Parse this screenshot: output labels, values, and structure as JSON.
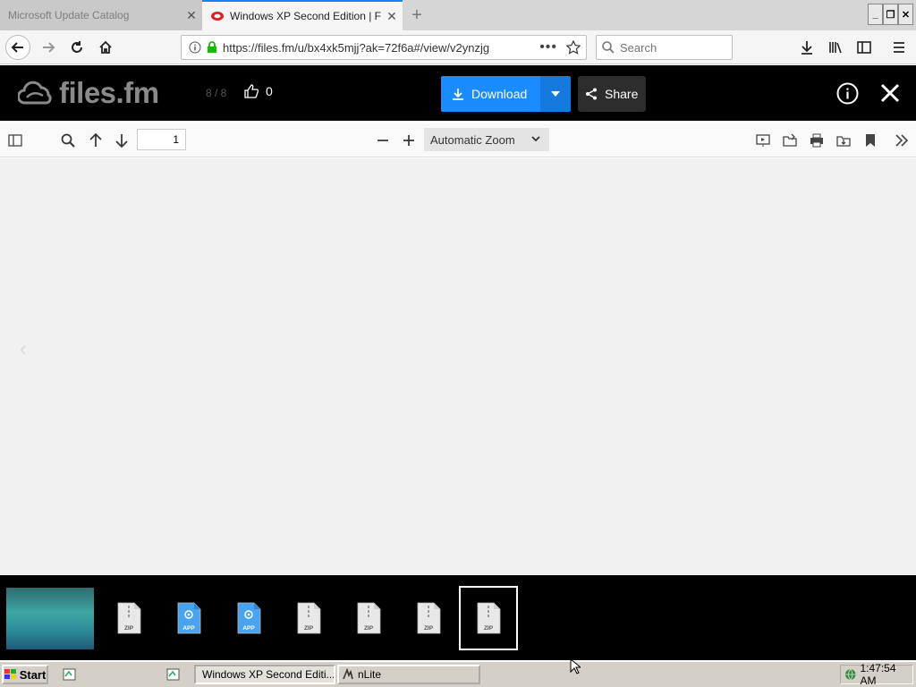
{
  "browser": {
    "tabs": [
      {
        "title": "Microsoft Update Catalog",
        "active": false
      },
      {
        "title": "Windows XP Second Edition | Files",
        "active": true
      }
    ],
    "url": "https://files.fm/u/bx4xk5mjj?ak=72f6a#/view/v2ynzjg",
    "search_placeholder": "Search"
  },
  "viewer_header": {
    "logo_text": "files.fm",
    "counter": "8 / 8",
    "likes": "0",
    "download_label": "Download",
    "share_label": "Share"
  },
  "pdf_toolbar": {
    "page_number": "1",
    "zoom_label": "Automatic Zoom"
  },
  "thumbnails": [
    {
      "kind": "image",
      "label": ""
    },
    {
      "kind": "zip",
      "label": "ZIP"
    },
    {
      "kind": "app",
      "label": "APP"
    },
    {
      "kind": "app",
      "label": "APP"
    },
    {
      "kind": "zip",
      "label": "ZIP"
    },
    {
      "kind": "zip",
      "label": "ZIP"
    },
    {
      "kind": "zip",
      "label": "ZIP"
    },
    {
      "kind": "zip",
      "label": "ZIP",
      "selected": true
    }
  ],
  "taskbar": {
    "start_label": "Start",
    "tasks": [
      "Windows XP Second Editi...",
      "nLite"
    ],
    "clock": "1:47:54 AM"
  },
  "colors": {
    "accent_blue": "#1a8cff",
    "header_bg": "#000000",
    "viewer_bg": "#f1f1f1"
  }
}
